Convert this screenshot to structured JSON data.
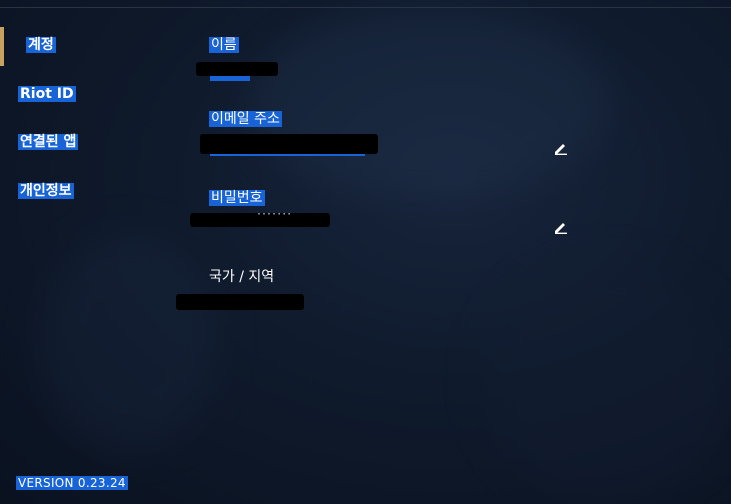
{
  "sidebar": {
    "items": [
      {
        "label": "계정"
      },
      {
        "label": "Riot ID"
      },
      {
        "label": "연결된 앱"
      },
      {
        "label": "개인정보"
      }
    ]
  },
  "fields": {
    "name": {
      "label": "이름"
    },
    "email": {
      "label": "이메일 주소",
      "edit_icon": "pencil-icon"
    },
    "password": {
      "label": "비밀번호",
      "masked_value": "·······",
      "edit_icon": "pencil-icon"
    },
    "region": {
      "label": "국가 / 지역"
    }
  },
  "footer": {
    "version": "VERSION 0.23.24"
  },
  "colors": {
    "background": "#0f1a2c",
    "selection": "#1864d6",
    "accent": "#c9a15f",
    "text": "#ffffff"
  }
}
